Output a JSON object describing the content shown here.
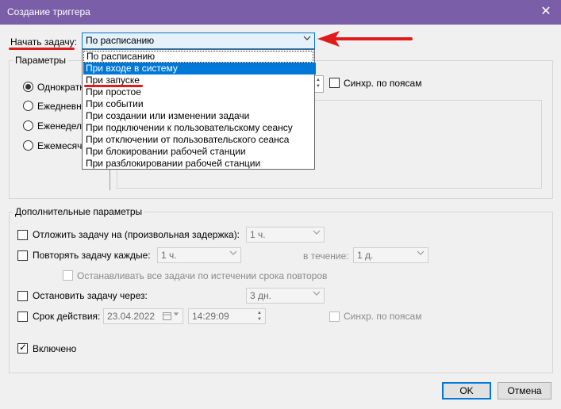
{
  "window": {
    "title": "Создание триггера",
    "close_glyph": "✕"
  },
  "start": {
    "label": "Начать задачу:",
    "value": "По расписанию",
    "options": [
      "По расписанию",
      "При входе в систему",
      "При запуске",
      "При простое",
      "При событии",
      "При создании или изменении задачи",
      "При подключении к пользовательскому сеансу",
      "При отключении от пользовательского сеанса",
      "При блокировании рабочей станции",
      "При разблокировании рабочей станции"
    ],
    "highlighted_option": "При входе в систему"
  },
  "params": {
    "legend": "Параметры",
    "radios": [
      "Однократно",
      "Ежедневно",
      "Еженедельно",
      "Ежемесячно"
    ],
    "radios_visible": [
      "Однократн",
      "Ежедневно",
      "Еженедельн",
      "Ежемесячн"
    ],
    "selected_radio": "Однократно",
    "sync_label": "Синхр. по поясам"
  },
  "advanced": {
    "legend": "Дополнительные параметры",
    "delay_label": "Отложить задачу на (произвольная задержка):",
    "delay_value": "1 ч.",
    "repeat_label": "Повторять задачу каждые:",
    "repeat_value": "1 ч.",
    "duration_label": "в течение:",
    "duration_value": "1 д.",
    "stop_all_label": "Останавливать все задачи по истечении срока повторов",
    "stop_after_label": "Остановить задачу через:",
    "stop_after_value": "3 дн.",
    "expire_label": "Срок действия:",
    "expire_date": "23.04.2022",
    "expire_time": "14:29:09",
    "expire_sync_label": "Синхр. по поясам",
    "enabled_label": "Включено",
    "enabled_checked": true
  },
  "buttons": {
    "ok": "OK",
    "cancel": "Отмена"
  },
  "icons": {
    "combo_arrow": "chevron-down-icon",
    "check_mark": "✓",
    "calendar": "calendar-icon",
    "annotation_arrow": "red-arrow-icon"
  },
  "colors": {
    "titlebar": "#7a5fa8",
    "highlight": "#0078d7",
    "annotation": "#e01b1b"
  }
}
